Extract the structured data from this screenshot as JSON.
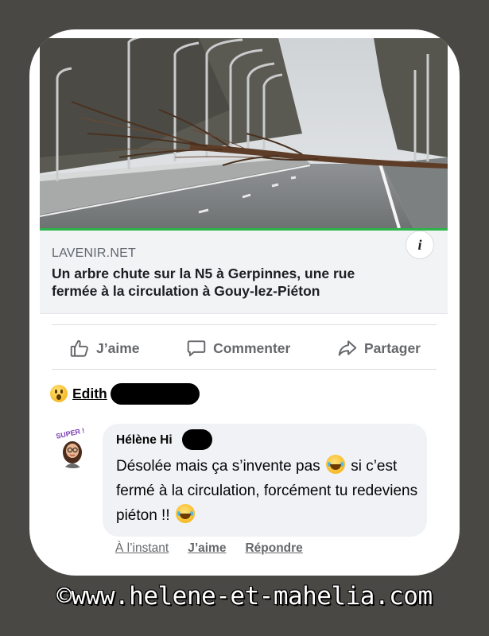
{
  "post": {
    "link_domain": "LAVENIR.NET",
    "link_title": "Un arbre chute sur la N5 à Gerpinnes, une rue fermée à la circulation à Gouy-lez-Piéton",
    "info_label": "i"
  },
  "actions": {
    "like_label": "J’aime",
    "comment_label": "Commenter",
    "share_label": "Partager"
  },
  "reaction": {
    "name": "Edith"
  },
  "comment": {
    "author": "Hélène Hi",
    "text_part1": "Désolée mais ça s’invente pas",
    "text_part2": "si c’est fermé à la circulation, forcément tu redeviens piéton !!",
    "time": "À l’instant",
    "like_label": "J’aime",
    "reply_label": "Répondre",
    "avatar_badge": "SUPER !"
  },
  "watermark": "©www.helene-et-mahelia.com",
  "colors": {
    "background": "#4a4845",
    "card": "#ffffff",
    "link_box": "#f2f3f5",
    "comment_bubble": "#f0f2f5",
    "secondary_text": "#65676b",
    "accent_bar": "#2bb54a"
  }
}
